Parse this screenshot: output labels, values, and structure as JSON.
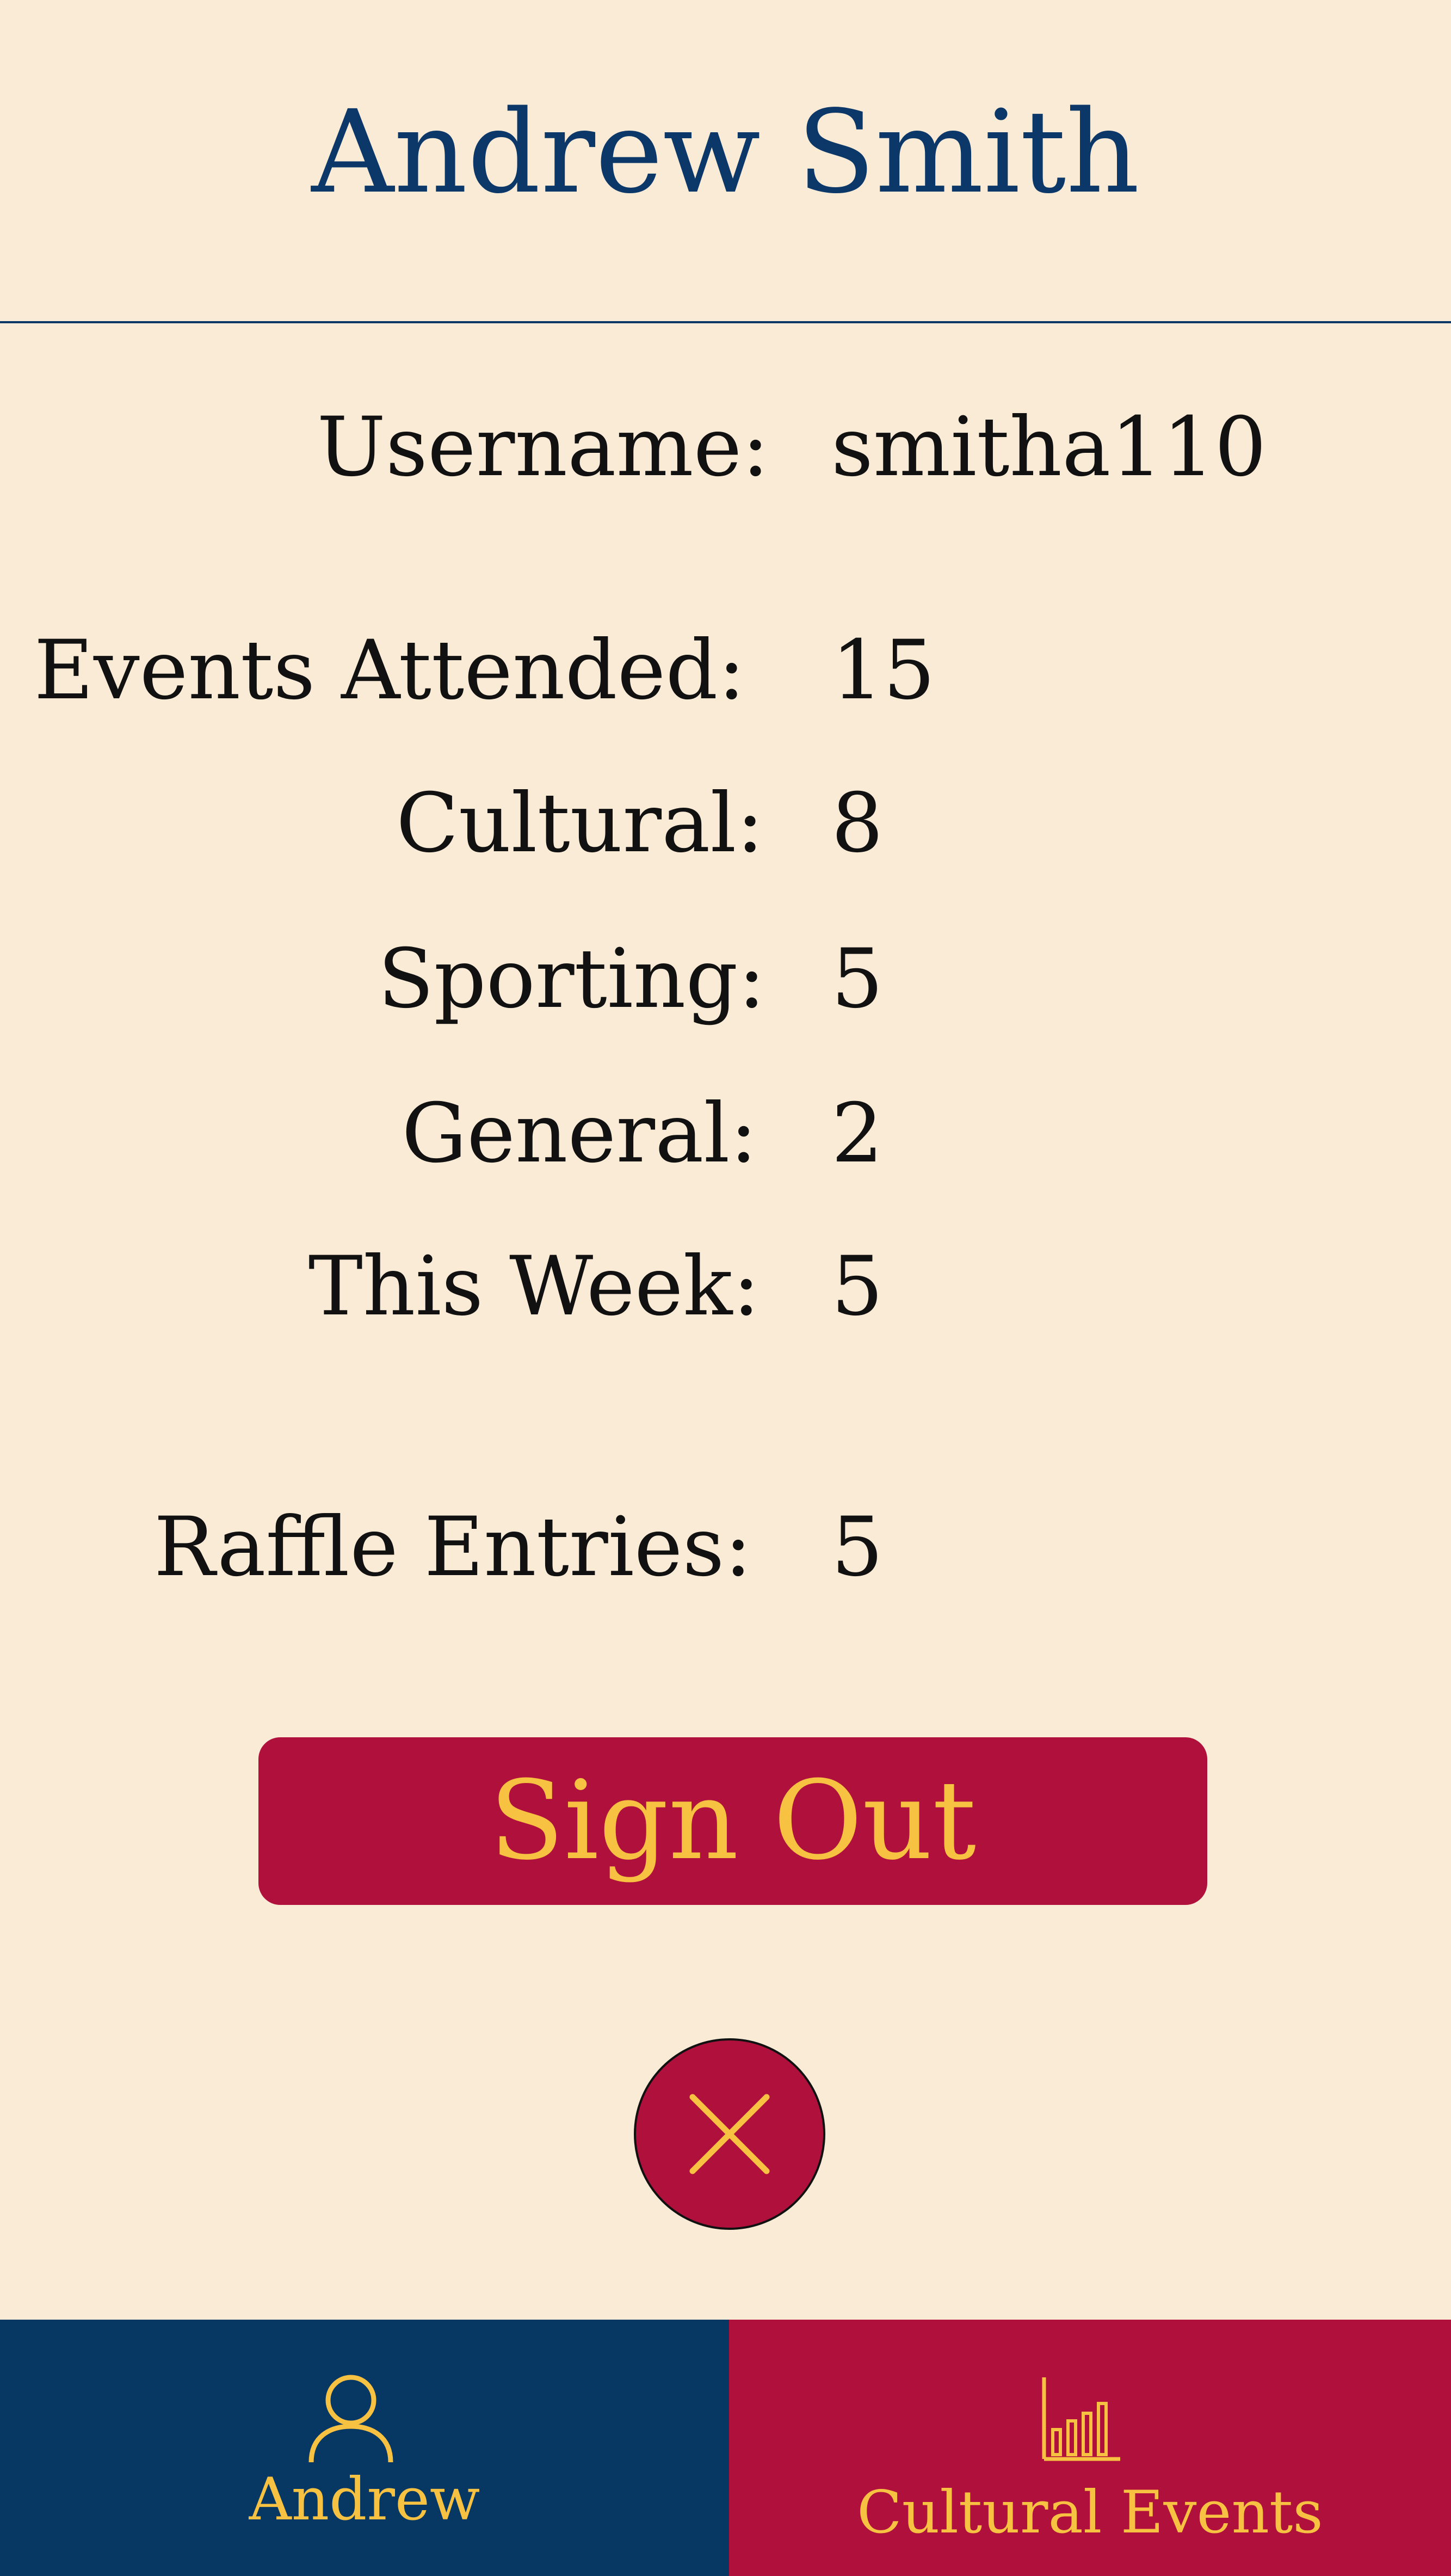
{
  "header": {
    "title": "Andrew Smith"
  },
  "profile": {
    "username_label": "Username:",
    "username_value": "smitha110",
    "events_attended_label": "Events Attended:",
    "events_attended_value": "15",
    "cultural_label": "Cultural:",
    "cultural_value": "8",
    "sporting_label": "Sporting:",
    "sporting_value": "5",
    "general_label": "General:",
    "general_value": "2",
    "this_week_label": "This Week:",
    "this_week_value": "5",
    "raffle_entries_label": "Raffle Entries:",
    "raffle_entries_value": "5"
  },
  "actions": {
    "sign_out_label": "Sign Out",
    "close_icon": "close-icon"
  },
  "tabbar": {
    "tabs": [
      {
        "label": "Andrew",
        "icon": "user-icon"
      },
      {
        "label": "Cultural Events",
        "icon": "bar-chart-icon"
      }
    ]
  },
  "colors": {
    "background": "#FAEBD7",
    "navy": "#073763",
    "crimson": "#B0103C",
    "gold": "#F7C141"
  }
}
